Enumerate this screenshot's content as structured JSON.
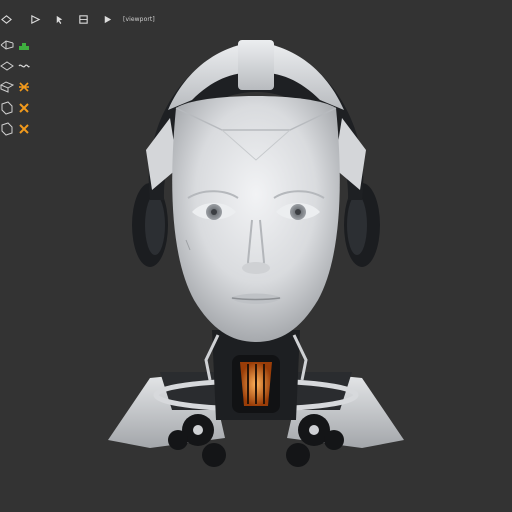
{
  "toolbar": {
    "tools": [
      {
        "icon": "select-arrow-icon"
      },
      {
        "icon": "move-arrow-icon"
      },
      {
        "icon": "pointer-icon"
      },
      {
        "icon": "settings-icon"
      },
      {
        "icon": "play-icon"
      }
    ],
    "label": "[viewport]"
  },
  "outliner": {
    "rows": [
      {
        "icon": "mesh-object-icon",
        "badge_icon": "modifier-wrench-icon",
        "badge_color": "#3fae3f"
      },
      {
        "icon": "mesh-object-icon",
        "badge_icon": "link-icon",
        "badge_color": "#d9d9d9"
      },
      {
        "icon": "mesh-object-icon",
        "badge_icon": "material-icon",
        "badge_color": "#f29a1c"
      },
      {
        "icon": "mesh-object-icon",
        "badge_icon": "cross-icon",
        "badge_color": "#f29a1c"
      },
      {
        "icon": "mesh-object-icon",
        "badge_icon": "cross-icon",
        "badge_color": "#f29a1c"
      }
    ]
  },
  "colors": {
    "background": "#333333",
    "head_shell": "#e3e5e8",
    "headphone": "#1b1d20",
    "glow": "#e07a22"
  }
}
